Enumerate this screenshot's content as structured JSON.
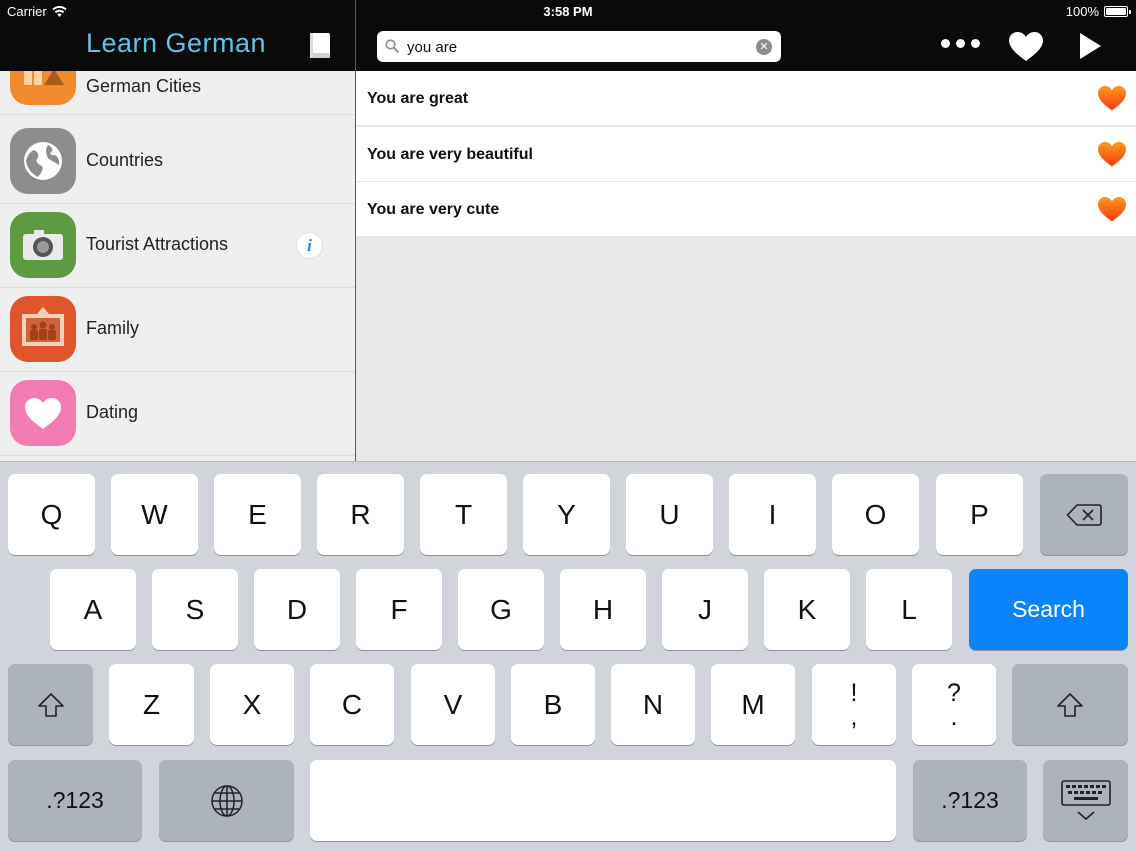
{
  "status": {
    "carrier": "Carrier",
    "time": "3:58 PM",
    "battery": "100%"
  },
  "app": {
    "title": "Learn German"
  },
  "search": {
    "value": "you are"
  },
  "sidebar": {
    "items": [
      {
        "label": "German Cities",
        "icon": "buildings-icon",
        "color": "#f28a2e"
      },
      {
        "label": "Countries",
        "icon": "globe-icon",
        "color": "#8d8d8d"
      },
      {
        "label": "Tourist Attractions",
        "icon": "camera-icon",
        "color": "#5e9a3f"
      },
      {
        "label": "Family",
        "icon": "family-picture-icon",
        "color": "#e0552a"
      },
      {
        "label": "Dating",
        "icon": "heart-icon",
        "color": "#f27bb3"
      }
    ],
    "info_glyph": "i"
  },
  "results": [
    {
      "text": "You are great"
    },
    {
      "text": "You are very beautiful"
    },
    {
      "text": "You are very cute"
    }
  ],
  "keyboard": {
    "row1": [
      "Q",
      "W",
      "E",
      "R",
      "T",
      "Y",
      "U",
      "I",
      "O",
      "P"
    ],
    "row2": [
      "A",
      "S",
      "D",
      "F",
      "G",
      "H",
      "J",
      "K",
      "L"
    ],
    "row3": [
      "Z",
      "X",
      "C",
      "V",
      "B",
      "N",
      "M"
    ],
    "punct1": {
      "top": "!",
      "bottom": ","
    },
    "punct2": {
      "top": "?",
      "bottom": "."
    },
    "search_label": "Search",
    "numbers_label": ".?123"
  }
}
